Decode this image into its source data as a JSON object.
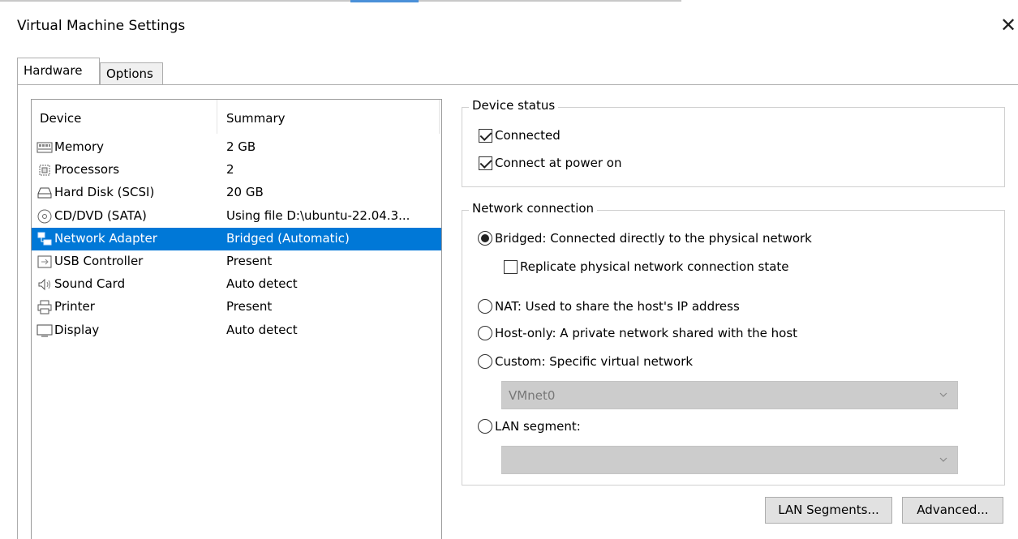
{
  "window": {
    "title": "Virtual Machine Settings",
    "close_glyph": "✕"
  },
  "tabs": [
    {
      "label": "Hardware",
      "active": true
    },
    {
      "label": "Options",
      "active": false
    }
  ],
  "device_list": {
    "columns": [
      "Device",
      "Summary"
    ],
    "rows": [
      {
        "name": "Memory",
        "summary": "2 GB",
        "icon": "memory-icon"
      },
      {
        "name": "Processors",
        "summary": "2",
        "icon": "processor-icon"
      },
      {
        "name": "Hard Disk (SCSI)",
        "summary": "20 GB",
        "icon": "hard-disk-icon"
      },
      {
        "name": "CD/DVD (SATA)",
        "summary": "Using file D:\\ubuntu-22.04.3...",
        "icon": "cd-dvd-icon"
      },
      {
        "name": "Network Adapter",
        "summary": "Bridged (Automatic)",
        "icon": "network-adapter-icon",
        "selected": true
      },
      {
        "name": "USB Controller",
        "summary": "Present",
        "icon": "usb-icon"
      },
      {
        "name": "Sound Card",
        "summary": "Auto detect",
        "icon": "speaker-icon"
      },
      {
        "name": "Printer",
        "summary": "Present",
        "icon": "printer-icon"
      },
      {
        "name": "Display",
        "summary": "Auto detect",
        "icon": "display-icon"
      }
    ]
  },
  "device_status": {
    "legend": "Device status",
    "connected": {
      "label": "Connected",
      "checked": true
    },
    "connect_at_power_on": {
      "label": "Connect at power on",
      "checked": true
    }
  },
  "network_connection": {
    "legend": "Network connection",
    "bridged": {
      "label": "Bridged: Connected directly to the physical network",
      "checked": true
    },
    "replicate": {
      "label": "Replicate physical network connection state",
      "checked": false
    },
    "nat": {
      "label": "NAT: Used to share the host's IP address",
      "checked": false
    },
    "host_only": {
      "label": "Host-only: A private network shared with the host",
      "checked": false
    },
    "custom": {
      "label": "Custom: Specific virtual network",
      "checked": false
    },
    "custom_select": {
      "value": "VMnet0"
    },
    "lan_segment": {
      "label": "LAN segment:",
      "checked": false
    },
    "lan_select": {
      "value": ""
    }
  },
  "buttons": {
    "lan_segments": "LAN Segments...",
    "advanced": "Advanced..."
  },
  "colors": {
    "selection": "#0078d7",
    "disabled_combo": "#cccccc"
  }
}
